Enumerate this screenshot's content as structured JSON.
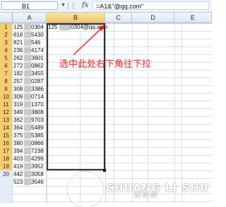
{
  "formula_bar": {
    "name_box": "B1",
    "fx_symbol": "fx",
    "formula": "=A1&\"@qq.com\""
  },
  "columns": [
    "A",
    "B",
    "C",
    "D",
    "E"
  ],
  "rows": [
    "1",
    "2",
    "3",
    "4",
    "5",
    "6",
    "7",
    "8",
    "9",
    "10",
    "11",
    "12",
    "13",
    "14",
    "15",
    "16",
    "17",
    "18",
    "19",
    "20"
  ],
  "cells_a_left": [
    "125",
    "616",
    "821",
    "236",
    "262",
    "272",
    "182",
    "257",
    "308",
    "309",
    "319",
    "349",
    "362",
    "364",
    "375",
    "380",
    "394",
    "403",
    "419",
    "442",
    "523"
  ],
  "cells_a_right": [
    "0304",
    "5430",
    "546",
    "4174",
    "3601",
    "0862",
    "3455",
    "0287",
    "3386",
    "0714",
    "1370",
    "3808",
    "9703",
    "5489",
    "5385",
    "0866",
    "7238",
    "4299",
    "3952",
    "3058",
    "3546"
  ],
  "b1_value_left": "125",
  "b1_value_right": "0304@qq.com",
  "annotation": "选中此处右下角往下拉",
  "watermark": {
    "title": "CHUANG LI SHU",
    "subtitle": "创 利 树",
    "extra": "IS 本的"
  },
  "colors": {
    "annotation": "#e0161b",
    "selection_border": "#222222",
    "header_selected": "#f2c767"
  }
}
